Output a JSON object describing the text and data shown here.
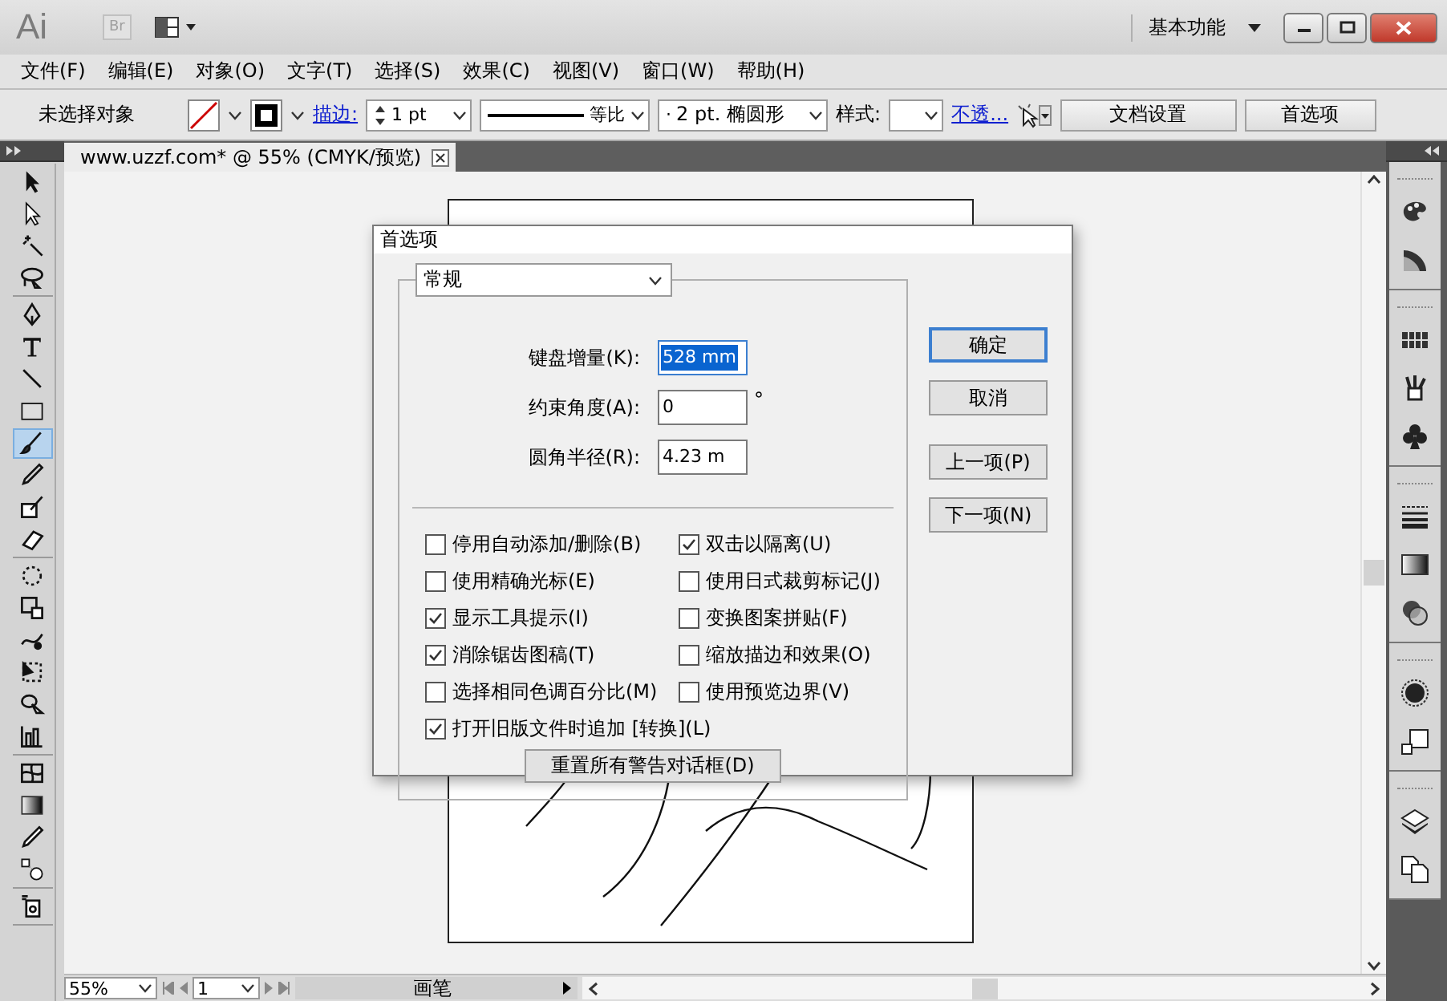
{
  "app": {
    "logo": "Ai",
    "bridge": "Br",
    "workspace": "基本功能"
  },
  "menu": [
    "文件(F)",
    "编辑(E)",
    "对象(O)",
    "文字(T)",
    "选择(S)",
    "效果(C)",
    "视图(V)",
    "窗口(W)",
    "帮助(H)"
  ],
  "control_bar": {
    "selection": "未选择对象",
    "stroke_label": "描边:",
    "stroke_weight": "1 pt",
    "stroke_profile": "等比",
    "brush_marker": "·",
    "brush": "2 pt. 椭圆形",
    "style_label": "样式:",
    "opacity_link": "不透...",
    "buttons": [
      "文档设置",
      "首选项"
    ]
  },
  "document_tab": {
    "title": "www.uzzf.com* @ 55% (CMYK/预览)"
  },
  "tool_groups": [
    [
      {
        "kind": "selection",
        "selected": false
      },
      {
        "kind": "direct-selection",
        "selected": false
      },
      {
        "kind": "magic-wand",
        "selected": false
      },
      {
        "kind": "lasso",
        "selected": false
      }
    ],
    [
      {
        "kind": "pen",
        "selected": false
      },
      {
        "kind": "type",
        "selected": false
      },
      {
        "kind": "line",
        "selected": false
      },
      {
        "kind": "rectangle",
        "selected": false
      },
      {
        "kind": "brush",
        "selected": true
      },
      {
        "kind": "pencil",
        "selected": false
      },
      {
        "kind": "blob-brush",
        "selected": false
      },
      {
        "kind": "eraser",
        "selected": false
      }
    ],
    [
      {
        "kind": "rotate",
        "selected": false
      },
      {
        "kind": "scale",
        "selected": false
      },
      {
        "kind": "warp",
        "selected": false
      },
      {
        "kind": "free-transform",
        "selected": false
      },
      {
        "kind": "sprayer",
        "selected": false
      },
      {
        "kind": "graph",
        "selected": false
      }
    ],
    [
      {
        "kind": "mesh",
        "selected": false
      },
      {
        "kind": "gradient",
        "selected": false
      },
      {
        "kind": "eyedropper",
        "selected": false
      },
      {
        "kind": "blend",
        "selected": false
      }
    ],
    [
      {
        "kind": "live-paint",
        "selected": false
      }
    ]
  ],
  "dialog": {
    "title": "首选项",
    "section": "常规",
    "fields": [
      {
        "label": "键盘增量(K):",
        "value": "528 mm",
        "selected": true
      },
      {
        "label": "约束角度(A):",
        "value": "0",
        "unit": "°",
        "selected": false
      },
      {
        "label": "圆角半径(R):",
        "value": "4.23 m",
        "selected": false
      }
    ],
    "options": [
      {
        "label": "停用自动添加/删除(B)",
        "checked": false
      },
      {
        "label": "双击以隔离(U)",
        "checked": true
      },
      {
        "label": "使用精确光标(E)",
        "checked": false
      },
      {
        "label": "使用日式裁剪标记(J)",
        "checked": false
      },
      {
        "label": "显示工具提示(I)",
        "checked": true
      },
      {
        "label": "变换图案拼贴(F)",
        "checked": false
      },
      {
        "label": "消除锯齿图稿(T)",
        "checked": true
      },
      {
        "label": "缩放描边和效果(O)",
        "checked": false
      },
      {
        "label": "选择相同色调百分比(M)",
        "checked": false
      },
      {
        "label": "使用预览边界(V)",
        "checked": false
      },
      {
        "label": "打开旧版文件时追加 [转换](L)",
        "checked": true
      }
    ],
    "reset_button": "重置所有警告对话框(D)",
    "button_groups": [
      [
        {
          "label": "确定",
          "kind": "default"
        },
        {
          "label": "取消",
          "kind": "normal"
        }
      ],
      [
        {
          "label": "上一项(P)",
          "kind": "normal"
        },
        {
          "label": "下一项(N)",
          "kind": "normal"
        }
      ]
    ]
  },
  "status_bar": {
    "zoom": "55%",
    "page": "1",
    "tool": "画笔"
  }
}
